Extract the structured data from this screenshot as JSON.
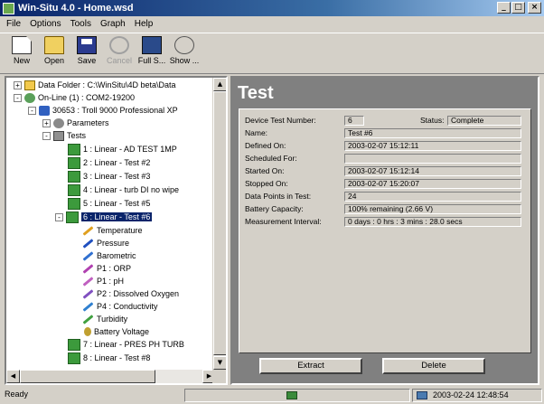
{
  "window": {
    "title": "Win-Situ 4.0 - Home.wsd",
    "controls": [
      "_",
      "□",
      "×"
    ]
  },
  "menu": [
    "File",
    "Options",
    "Tools",
    "Graph",
    "Help"
  ],
  "toolbar": [
    {
      "label": "New",
      "icon": "new-icon",
      "enabled": true
    },
    {
      "label": "Open",
      "icon": "open-icon",
      "enabled": true
    },
    {
      "label": "Save",
      "icon": "save-icon",
      "enabled": true
    },
    {
      "label": "Cancel",
      "icon": "cancel-icon",
      "enabled": false
    },
    {
      "label": "Full S...",
      "icon": "full-screen-icon",
      "enabled": true
    },
    {
      "label": "Show ...",
      "icon": "show-icon",
      "enabled": true
    }
  ],
  "tree": {
    "nodes": [
      {
        "label": "Data Folder : C:\\WinSitu\\4D beta\\Data",
        "icon": "folder-icon",
        "expander": "+"
      },
      {
        "label": "On-Line (1) : COM2-19200",
        "icon": "network-icon",
        "expander": "-"
      },
      {
        "label": "30653 : Troll 9000 Professional XP",
        "icon": "device-icon",
        "expander": "-"
      },
      {
        "label": "Parameters",
        "icon": "parameters-icon",
        "expander": "+"
      },
      {
        "label": "Tests",
        "icon": "tests-icon",
        "expander": "-"
      },
      {
        "label": "1 : Linear - AD TEST 1MP",
        "icon": "test-icon"
      },
      {
        "label": "2 : Linear - Test #2",
        "icon": "test-icon"
      },
      {
        "label": "3 : Linear - Test #3",
        "icon": "test-icon"
      },
      {
        "label": "4 : Linear - turb DI no wipe",
        "icon": "test-icon"
      },
      {
        "label": "5 : Linear - Test #5",
        "icon": "test-icon"
      },
      {
        "label": "6 : Linear - Test #6",
        "icon": "test-icon",
        "selected": true,
        "expander": "-"
      },
      {
        "label": "Temperature",
        "icon": "pencil-icon",
        "color": "#e0a020"
      },
      {
        "label": "Pressure",
        "icon": "pencil-icon",
        "color": "#2050c0"
      },
      {
        "label": "Barometric",
        "icon": "pencil-icon",
        "color": "#3070d0"
      },
      {
        "label": "P1 : ORP",
        "icon": "pencil-icon",
        "color": "#b040b0"
      },
      {
        "label": "P1 : pH",
        "icon": "pencil-icon",
        "color": "#c060c0"
      },
      {
        "label": "P2 : Dissolved Oxygen",
        "icon": "pencil-icon",
        "color": "#8050c0"
      },
      {
        "label": "P4 : Conductivity",
        "icon": "pencil-icon",
        "color": "#3080d0"
      },
      {
        "label": "Turbidity",
        "icon": "pencil-icon",
        "color": "#40a040"
      },
      {
        "label": "Battery Voltage",
        "icon": "battery-icon"
      },
      {
        "label": "7 : Linear - PRES PH TURB",
        "icon": "test-icon"
      },
      {
        "label": "8 : Linear - Test #8",
        "icon": "test-icon"
      }
    ]
  },
  "panel": {
    "title": "Test",
    "fields": [
      {
        "label": "Device Test Number:",
        "value": "6"
      },
      {
        "label": "Name:",
        "value": "Test #6"
      },
      {
        "label": "Defined On:",
        "value": "2003-02-07 15:12:11"
      },
      {
        "label": "Scheduled For:",
        "value": ""
      },
      {
        "label": "Started On:",
        "value": "2003-02-07 15:12:14"
      },
      {
        "label": "Stopped On:",
        "value": "2003-02-07 15:20:07"
      },
      {
        "label": "Data Points in Test:",
        "value": "24"
      },
      {
        "label": "Battery Capacity:",
        "value": "100% remaining (2.66 V)"
      },
      {
        "label": "Measurement Interval:",
        "value": "0 days : 0 hrs : 3 mins : 28.0 secs"
      }
    ],
    "status_label": "Status:",
    "status_value": "Complete",
    "extract_label": "Extract",
    "delete_label": "Delete"
  },
  "statusbar": {
    "text": "Ready",
    "datetime": "2003-02-24  12:48:54"
  },
  "colors": {
    "titlebar": "#0a246a",
    "selection": "#0a246a",
    "panel_bg": "#808080",
    "face": "#d4d0c8"
  }
}
